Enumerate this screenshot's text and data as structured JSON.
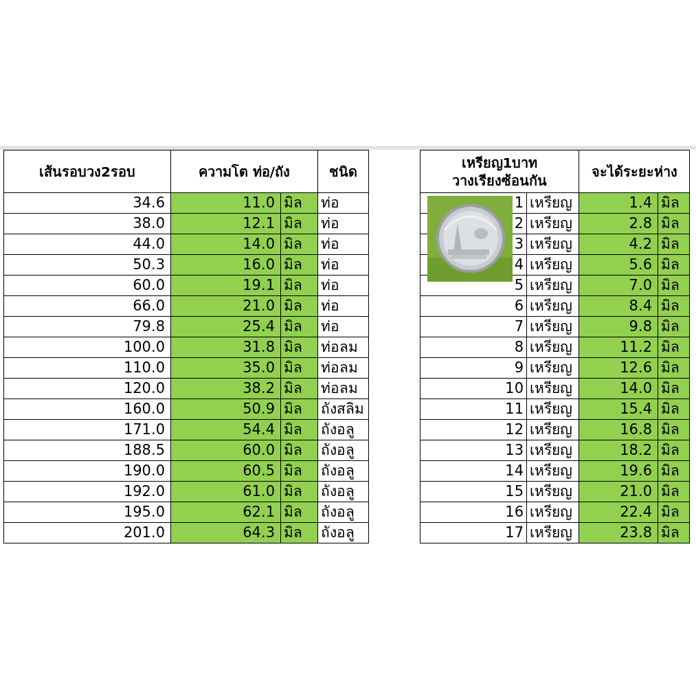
{
  "pipe_table": {
    "columns": [
      "เส้นรอบวง2รอบ",
      "ความโต ท่อ/ถัง",
      "ชนิด"
    ],
    "rows": [
      {
        "circumference": "34.6",
        "diameter": "11.0",
        "unit": "มิล",
        "type": "ท่อ"
      },
      {
        "circumference": "38.0",
        "diameter": "12.1",
        "unit": "มิล",
        "type": "ท่อ"
      },
      {
        "circumference": "44.0",
        "diameter": "14.0",
        "unit": "มิล",
        "type": "ท่อ"
      },
      {
        "circumference": "50.3",
        "diameter": "16.0",
        "unit": "มิล",
        "type": "ท่อ"
      },
      {
        "circumference": "60.0",
        "diameter": "19.1",
        "unit": "มิล",
        "type": "ท่อ"
      },
      {
        "circumference": "66.0",
        "diameter": "21.0",
        "unit": "มิล",
        "type": "ท่อ"
      },
      {
        "circumference": "79.8",
        "diameter": "25.4",
        "unit": "มิล",
        "type": "ท่อ"
      },
      {
        "circumference": "100.0",
        "diameter": "31.8",
        "unit": "มิล",
        "type": "ท่อลม"
      },
      {
        "circumference": "110.0",
        "diameter": "35.0",
        "unit": "มิล",
        "type": "ท่อลม"
      },
      {
        "circumference": "120.0",
        "diameter": "38.2",
        "unit": "มิล",
        "type": "ท่อลม"
      },
      {
        "circumference": "160.0",
        "diameter": "50.9",
        "unit": "มิล",
        "type": "ถังสลิม"
      },
      {
        "circumference": "171.0",
        "diameter": "54.4",
        "unit": "มิล",
        "type": "ถังอลู"
      },
      {
        "circumference": "188.5",
        "diameter": "60.0",
        "unit": "มิล",
        "type": "ถังอลู"
      },
      {
        "circumference": "190.0",
        "diameter": "60.5",
        "unit": "มิล",
        "type": "ถังอลู"
      },
      {
        "circumference": "192.0",
        "diameter": "61.0",
        "unit": "มิล",
        "type": "ถังอลู"
      },
      {
        "circumference": "195.0",
        "diameter": "62.1",
        "unit": "มิล",
        "type": "ถังอลู"
      },
      {
        "circumference": "201.0",
        "diameter": "64.3",
        "unit": "มิล",
        "type": "ถังอลู"
      }
    ]
  },
  "coin_table": {
    "columns": [
      [
        "เหรียญ1บาท",
        "วางเรียงซ้อนกัน"
      ],
      [
        "จะได้ระยะห่าง"
      ]
    ],
    "photo": {
      "kind": "picture"
    },
    "rows": [
      {
        "count": "1",
        "item": "เหรียญ",
        "spacing": "1.4",
        "unit": "มิล"
      },
      {
        "count": "2",
        "item": "เหรียญ",
        "spacing": "2.8",
        "unit": "มิล"
      },
      {
        "count": "3",
        "item": "เหรียญ",
        "spacing": "4.2",
        "unit": "มิล"
      },
      {
        "count": "4",
        "item": "เหรียญ",
        "spacing": "5.6",
        "unit": "มิล"
      },
      {
        "count": "5",
        "item": "เหรียญ",
        "spacing": "7.0",
        "unit": "มิล"
      },
      {
        "count": "6",
        "item": "เหรียญ",
        "spacing": "8.4",
        "unit": "มิล"
      },
      {
        "count": "7",
        "item": "เหรียญ",
        "spacing": "9.8",
        "unit": "มิล"
      },
      {
        "count": "8",
        "item": "เหรียญ",
        "spacing": "11.2",
        "unit": "มิล"
      },
      {
        "count": "9",
        "item": "เหรียญ",
        "spacing": "12.6",
        "unit": "มิล"
      },
      {
        "count": "10",
        "item": "เหรียญ",
        "spacing": "14.0",
        "unit": "มิล"
      },
      {
        "count": "11",
        "item": "เหรียญ",
        "spacing": "15.4",
        "unit": "มิล"
      },
      {
        "count": "12",
        "item": "เหรียญ",
        "spacing": "16.8",
        "unit": "มิล"
      },
      {
        "count": "13",
        "item": "เหรียญ",
        "spacing": "18.2",
        "unit": "มิล"
      },
      {
        "count": "14",
        "item": "เหรียญ",
        "spacing": "19.6",
        "unit": "มิล"
      },
      {
        "count": "15",
        "item": "เหรียญ",
        "spacing": "21.0",
        "unit": "มิล"
      },
      {
        "count": "16",
        "item": "เหรียญ",
        "spacing": "22.4",
        "unit": "มิล"
      },
      {
        "count": "17",
        "item": "เหรียญ",
        "spacing": "23.8",
        "unit": "มิล"
      }
    ]
  }
}
